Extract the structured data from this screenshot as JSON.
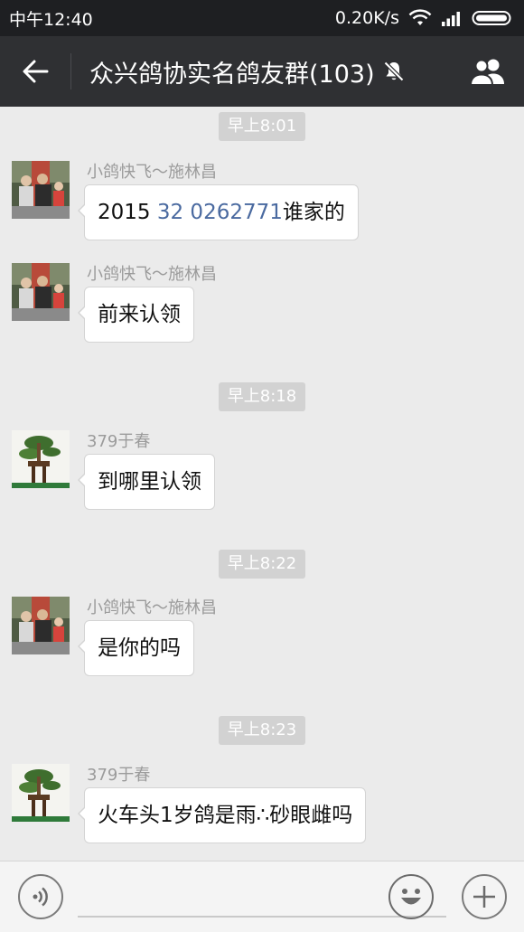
{
  "status_bar": {
    "time": "中午12:40",
    "network_speed": "0.20K/s"
  },
  "header": {
    "title": "众兴鸽协实名鸽友群(103)"
  },
  "timestamps": [
    "早上8:01",
    "早上8:18",
    "早上8:22",
    "早上8:23"
  ],
  "messages": [
    {
      "sender": "小鸽快飞～施林昌",
      "text_prefix": "2015 ",
      "text_link": "32 0262771",
      "text_suffix": "谁家的"
    },
    {
      "sender": "小鸽快飞～施林昌",
      "text": "前来认领"
    },
    {
      "sender": "379于春",
      "text": "到哪里认领"
    },
    {
      "sender": "小鸽快飞～施林昌",
      "text": "是你的吗"
    },
    {
      "sender": "379于春",
      "text": "火车头1岁鸽是雨∴砂眼雌吗"
    }
  ],
  "input_bar": {
    "value": ""
  },
  "colors": {
    "status_bg": "#1e1f22",
    "nav_bg": "#2f3033",
    "chat_bg": "#ebebeb",
    "link": "#4a6aa0"
  }
}
